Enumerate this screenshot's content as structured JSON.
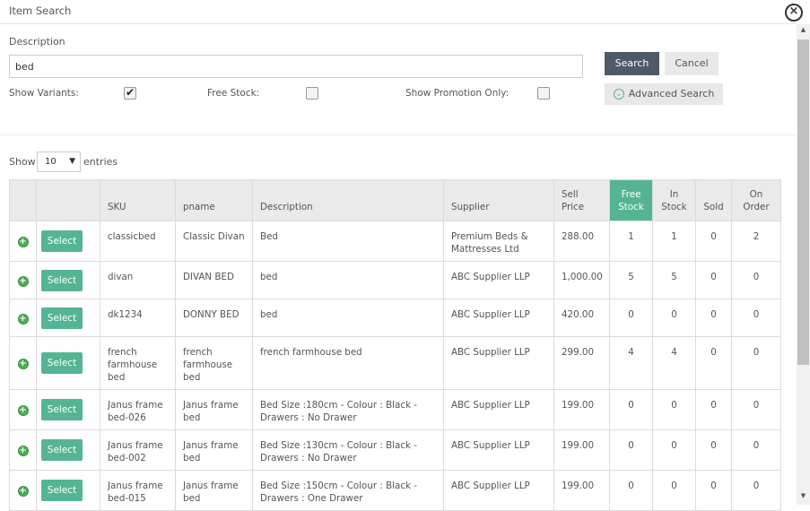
{
  "dialog": {
    "title": "Item Search",
    "close_glyph": "×"
  },
  "form": {
    "description_label": "Description",
    "search_value": "bed",
    "search_button": "Search",
    "cancel_button": "Cancel",
    "advanced_button": "Advanced Search",
    "show_variants_label": "Show Variants:",
    "show_variants_checked": true,
    "free_stock_label": "Free Stock:",
    "free_stock_checked": false,
    "promotion_label": "Show Promotion Only:",
    "promotion_checked": false
  },
  "entries": {
    "show_label": "Show",
    "value": "10",
    "suffix": "entries"
  },
  "table": {
    "headers": {
      "sku": "SKU",
      "pname": "pname",
      "description": "Description",
      "supplier": "Supplier",
      "sell_price": "Sell Price",
      "free_stock": "Free Stock",
      "in_stock": "In Stock",
      "sold": "Sold",
      "on_order": "On Order"
    },
    "select_label": "Select",
    "rows": [
      {
        "sku": "classicbed",
        "pname": "Classic Divan",
        "description": "Bed",
        "supplier": "Premium Beds & Mattresses Ltd",
        "price": "288.00",
        "free": "1",
        "instock": "1",
        "sold": "0",
        "onorder": "2"
      },
      {
        "sku": "divan",
        "pname": "DIVAN BED",
        "description": "bed",
        "supplier": "ABC Supplier LLP",
        "price": "1,000.00",
        "free": "5",
        "instock": "5",
        "sold": "0",
        "onorder": "0"
      },
      {
        "sku": "dk1234",
        "pname": "DONNY BED",
        "description": "bed",
        "supplier": "ABC Supplier LLP",
        "price": "420.00",
        "free": "0",
        "instock": "0",
        "sold": "0",
        "onorder": "0"
      },
      {
        "sku": "french farmhouse bed",
        "pname": "french farmhouse bed",
        "description": "french farmhouse bed",
        "supplier": "ABC Supplier LLP",
        "price": "299.00",
        "free": "4",
        "instock": "4",
        "sold": "0",
        "onorder": "0"
      },
      {
        "sku": "Janus frame bed-026",
        "pname": "Janus frame bed",
        "description": "Bed Size :180cm - Colour : Black - Drawers : No Drawer",
        "supplier": "ABC Supplier LLP",
        "price": "199.00",
        "free": "0",
        "instock": "0",
        "sold": "0",
        "onorder": "0"
      },
      {
        "sku": "Janus frame bed-002",
        "pname": "Janus frame bed",
        "description": "Bed Size :130cm - Colour : Black - Drawers : No Drawer",
        "supplier": "ABC Supplier LLP",
        "price": "199.00",
        "free": "0",
        "instock": "0",
        "sold": "0",
        "onorder": "0"
      },
      {
        "sku": "Janus frame bed-015",
        "pname": "Janus frame bed",
        "description": "Bed Size :150cm - Colour : Black - Drawers : One Drawer",
        "supplier": "ABC Supplier LLP",
        "price": "199.00",
        "free": "0",
        "instock": "0",
        "sold": "0",
        "onorder": "0"
      }
    ]
  },
  "colors": {
    "accent": "#55b592",
    "search_button": "#4f5a66",
    "plus_icon": "#4caf50"
  }
}
